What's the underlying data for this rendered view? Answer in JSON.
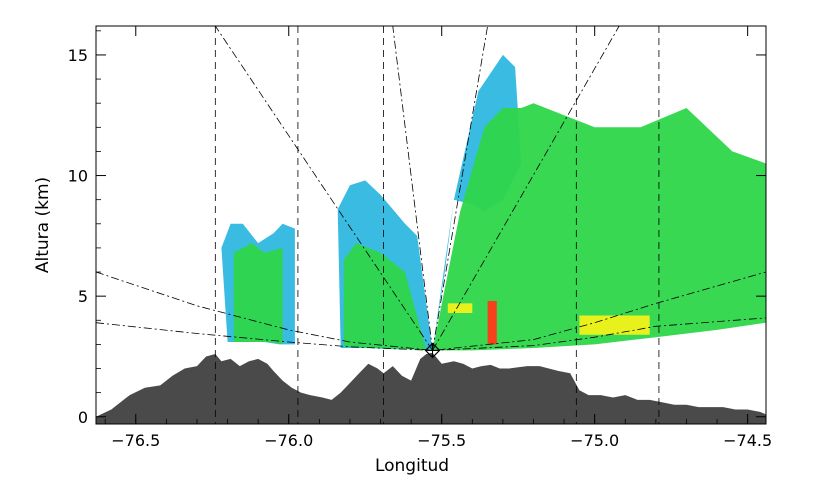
{
  "chart_data": {
    "type": "area",
    "title": "",
    "xlabel": "Longitud",
    "ylabel": "Altura (km)",
    "xlim": [
      -76.63,
      -74.44
    ],
    "ylim": [
      -0.3,
      16.2
    ],
    "x_ticks": [
      -76.5,
      -76.0,
      -75.5,
      -75.0,
      -74.5
    ],
    "x_tick_labels": [
      "−76.5",
      "−76.0",
      "−75.5",
      "−75.0",
      "−74.5"
    ],
    "y_ticks": [
      0,
      5,
      10,
      15
    ],
    "y_tick_labels": [
      "0",
      "5",
      "10",
      "15"
    ],
    "grid": false,
    "legend": "none",
    "radar_site": {
      "lon": -75.53,
      "alt": 2.75
    },
    "colors": {
      "terrain": "#4a4a4a",
      "reflectivity": [
        "#1a1ad0",
        "#2fb8e0",
        "#2ed64a",
        "#7fe84a",
        "#f2f21a",
        "#ff3a1a"
      ]
    },
    "terrain": {
      "x": [
        -76.63,
        -76.58,
        -76.52,
        -76.47,
        -76.42,
        -76.38,
        -76.34,
        -76.3,
        -76.27,
        -76.24,
        -76.22,
        -76.19,
        -76.16,
        -76.13,
        -76.1,
        -76.07,
        -76.05,
        -76.02,
        -75.99,
        -75.96,
        -75.93,
        -75.89,
        -75.86,
        -75.83,
        -75.8,
        -75.77,
        -75.74,
        -75.71,
        -75.69,
        -75.66,
        -75.63,
        -75.6,
        -75.57,
        -75.55,
        -75.53,
        -75.5,
        -75.46,
        -75.43,
        -75.4,
        -75.37,
        -75.34,
        -75.31,
        -75.28,
        -75.25,
        -75.22,
        -75.18,
        -75.15,
        -75.12,
        -75.08,
        -75.05,
        -75.02,
        -74.98,
        -74.94,
        -74.9,
        -74.86,
        -74.82,
        -74.78,
        -74.74,
        -74.7,
        -74.66,
        -74.62,
        -74.58,
        -74.54,
        -74.5,
        -74.46,
        -74.44
      ],
      "y": [
        0.0,
        0.3,
        0.9,
        1.2,
        1.3,
        1.7,
        2.0,
        2.1,
        2.5,
        2.6,
        2.3,
        2.4,
        2.1,
        2.3,
        2.4,
        2.2,
        1.9,
        1.5,
        1.2,
        1.0,
        0.9,
        0.8,
        0.7,
        1.0,
        1.4,
        1.8,
        2.2,
        2.0,
        1.8,
        2.1,
        1.7,
        1.5,
        2.4,
        2.6,
        2.65,
        2.2,
        2.3,
        2.2,
        2.0,
        2.1,
        2.15,
        2.0,
        2.0,
        2.05,
        2.1,
        2.1,
        2.0,
        1.9,
        1.8,
        1.1,
        0.9,
        0.9,
        0.8,
        0.9,
        0.7,
        0.7,
        0.6,
        0.5,
        0.5,
        0.4,
        0.4,
        0.4,
        0.3,
        0.3,
        0.2,
        0.1
      ]
    },
    "vertical_reference_lines": [
      -76.24,
      -75.97,
      -75.69,
      -75.06,
      -74.79
    ],
    "lowest_beam": {
      "x": [
        -76.63,
        -76.3,
        -76.0,
        -75.8,
        -75.53,
        -75.2,
        -75.0,
        -74.8,
        -74.44
      ],
      "y": [
        3.9,
        3.45,
        3.1,
        2.9,
        2.75,
        2.95,
        3.3,
        3.75,
        4.1
      ]
    },
    "second_beam": {
      "x": [
        -76.63,
        -76.3,
        -76.0,
        -75.8,
        -75.53,
        -75.2,
        -75.0,
        -74.8,
        -74.44
      ],
      "y": [
        6.0,
        4.6,
        3.6,
        3.1,
        2.75,
        3.2,
        3.9,
        4.7,
        6.0
      ]
    },
    "echo_regions": [
      {
        "level": 1,
        "x": [
          -76.2,
          -76.15,
          -76.08,
          -76.03,
          -75.98,
          -75.98,
          -76.02,
          -76.05,
          -76.1,
          -76.15,
          -76.19,
          -76.22
        ],
        "y": [
          3.1,
          3.1,
          3.1,
          3.0,
          3.0,
          7.8,
          8.0,
          7.6,
          7.2,
          8.0,
          8.0,
          7.0
        ]
      },
      {
        "level": 2,
        "x": [
          -76.18,
          -76.12,
          -76.06,
          -76.02,
          -76.02,
          -76.08,
          -76.12,
          -76.18
        ],
        "y": [
          3.1,
          3.1,
          3.1,
          3.0,
          7.0,
          6.8,
          7.2,
          6.8
        ]
      },
      {
        "level": 1,
        "x": [
          -75.83,
          -75.75,
          -75.66,
          -75.58,
          -75.53,
          -75.58,
          -75.62,
          -75.66,
          -75.7,
          -75.75,
          -75.8,
          -75.84
        ],
        "y": [
          2.85,
          2.85,
          2.8,
          2.8,
          2.75,
          7.5,
          8.0,
          8.6,
          9.2,
          9.8,
          9.6,
          8.6
        ]
      },
      {
        "level": 2,
        "x": [
          -75.82,
          -75.72,
          -75.6,
          -75.55,
          -75.62,
          -75.7,
          -75.78,
          -75.82
        ],
        "y": [
          2.9,
          2.85,
          2.8,
          2.75,
          6.0,
          6.8,
          7.2,
          6.5
        ]
      },
      {
        "level": 1,
        "x": [
          -75.53,
          -75.46,
          -75.38,
          -75.3,
          -75.26,
          -75.24,
          -75.3,
          -75.36,
          -75.4,
          -75.46,
          -75.49
        ],
        "y": [
          2.75,
          9.0,
          13.5,
          15.0,
          14.5,
          10.5,
          9.0,
          8.5,
          8.8,
          9.0,
          6.0
        ]
      },
      {
        "level": 2,
        "x": [
          -75.53,
          -75.44,
          -75.36,
          -75.3,
          -75.24,
          -75.2,
          -75.0,
          -74.85,
          -74.7,
          -74.55,
          -74.44,
          -74.44,
          -74.6,
          -74.8,
          -75.0,
          -75.2,
          -75.4
        ],
        "y": [
          2.75,
          8.5,
          12.0,
          12.8,
          12.8,
          13.0,
          12.0,
          12.0,
          12.8,
          11.0,
          10.5,
          3.9,
          3.6,
          3.3,
          3.0,
          2.85,
          2.75
        ]
      },
      {
        "level": 4,
        "x": [
          -75.48,
          -75.4,
          -75.4,
          -75.48
        ],
        "y": [
          4.3,
          4.3,
          4.7,
          4.7
        ]
      },
      {
        "level": 4,
        "x": [
          -75.05,
          -74.82,
          -74.82,
          -75.05
        ],
        "y": [
          3.4,
          3.4,
          4.2,
          4.2
        ]
      },
      {
        "level": 5,
        "x": [
          -75.35,
          -75.32,
          -75.32,
          -75.35
        ],
        "y": [
          3.0,
          3.0,
          4.8,
          4.8
        ]
      }
    ]
  }
}
